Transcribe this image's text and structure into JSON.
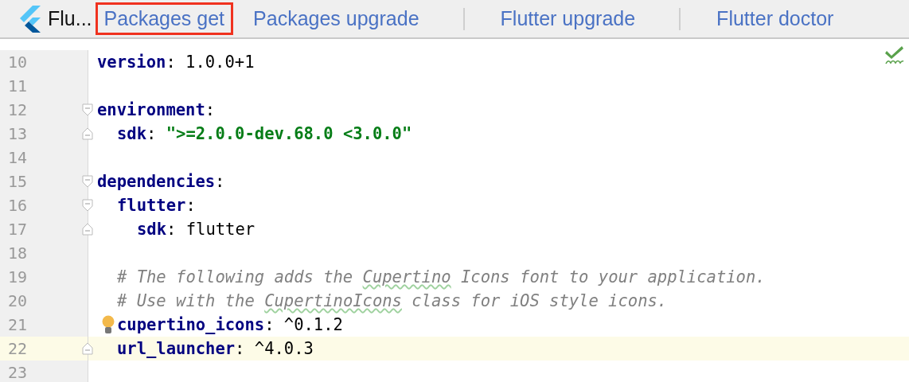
{
  "toolbar": {
    "title": "Flu...",
    "buttons": [
      {
        "label": "Packages get",
        "outlined": true,
        "separator_before": false
      },
      {
        "label": "Packages upgrade",
        "outlined": false,
        "separator_before": false
      },
      {
        "label": "Flutter upgrade",
        "outlined": false,
        "separator_before": true
      },
      {
        "label": "Flutter doctor",
        "outlined": false,
        "separator_before": true
      }
    ]
  },
  "editor": {
    "inspection_ok": true,
    "lines": [
      {
        "number": "10",
        "fold_start": false,
        "fold_end": false,
        "current": false,
        "intention": false,
        "segments": [
          {
            "kind": "key",
            "text": "version"
          },
          {
            "kind": "plain",
            "text": ": 1.0.0+1"
          }
        ]
      },
      {
        "number": "11",
        "fold_start": false,
        "fold_end": false,
        "current": false,
        "intention": false
      },
      {
        "number": "12",
        "fold_start": true,
        "fold_end": false,
        "current": false,
        "intention": false,
        "segments": [
          {
            "kind": "key",
            "text": "environment"
          },
          {
            "kind": "plain",
            "text": ":"
          }
        ],
        "children": [
          {
            "number": "13",
            "fold_start": false,
            "fold_end": true,
            "current": false,
            "intention": false,
            "segments": [
              {
                "kind": "key",
                "text": "sdk"
              },
              {
                "kind": "plain",
                "text": ": "
              },
              {
                "kind": "string",
                "text": "\">=2.0.0-dev.68.0 <3.0.0\""
              }
            ]
          }
        ]
      },
      {
        "number": "14",
        "fold_start": false,
        "fold_end": false,
        "current": false,
        "intention": false
      },
      {
        "number": "15",
        "fold_start": true,
        "fold_end": false,
        "current": false,
        "intention": false,
        "segments": [
          {
            "kind": "key",
            "text": "dependencies"
          },
          {
            "kind": "plain",
            "text": ":"
          }
        ],
        "children": [
          {
            "number": "16",
            "fold_start": true,
            "fold_end": false,
            "current": false,
            "intention": false,
            "segments": [
              {
                "kind": "key",
                "text": "flutter"
              },
              {
                "kind": "plain",
                "text": ":"
              }
            ],
            "children": [
              {
                "number": "17",
                "fold_start": false,
                "fold_end": true,
                "current": false,
                "intention": false,
                "segments": [
                  {
                    "kind": "key",
                    "text": "sdk"
                  },
                  {
                    "kind": "plain",
                    "text": ": flutter"
                  }
                ]
              }
            ]
          },
          {
            "number": "18",
            "fold_start": false,
            "fold_end": false,
            "current": false,
            "intention": false
          },
          {
            "number": "19",
            "fold_start": false,
            "fold_end": false,
            "current": false,
            "intention": false,
            "segments": [
              {
                "kind": "comment",
                "text": "# The following adds the "
              },
              {
                "kind": "comment_typo",
                "text": "Cupertino"
              },
              {
                "kind": "comment",
                "text": " Icons font to your application."
              }
            ]
          },
          {
            "number": "20",
            "fold_start": false,
            "fold_end": false,
            "current": false,
            "intention": false,
            "segments": [
              {
                "kind": "comment",
                "text": "# Use with the "
              },
              {
                "kind": "comment_typo",
                "text": "CupertinoIcons"
              },
              {
                "kind": "comment",
                "text": " class for iOS style icons."
              }
            ]
          },
          {
            "number": "21",
            "fold_start": false,
            "fold_end": false,
            "current": false,
            "intention": true,
            "segments": [
              {
                "kind": "key",
                "text": "cupertino_icons"
              },
              {
                "kind": "plain",
                "text": ": ^0.1.2"
              }
            ]
          },
          {
            "number": "22",
            "fold_start": false,
            "fold_end": true,
            "current": true,
            "intention": false,
            "segments": [
              {
                "kind": "key",
                "text": "url_launcher"
              },
              {
                "kind": "plain",
                "text": ": ^4.0.3"
              }
            ]
          }
        ]
      },
      {
        "number": "23",
        "fold_start": false,
        "fold_end": false,
        "current": false,
        "intention": false
      }
    ]
  }
}
